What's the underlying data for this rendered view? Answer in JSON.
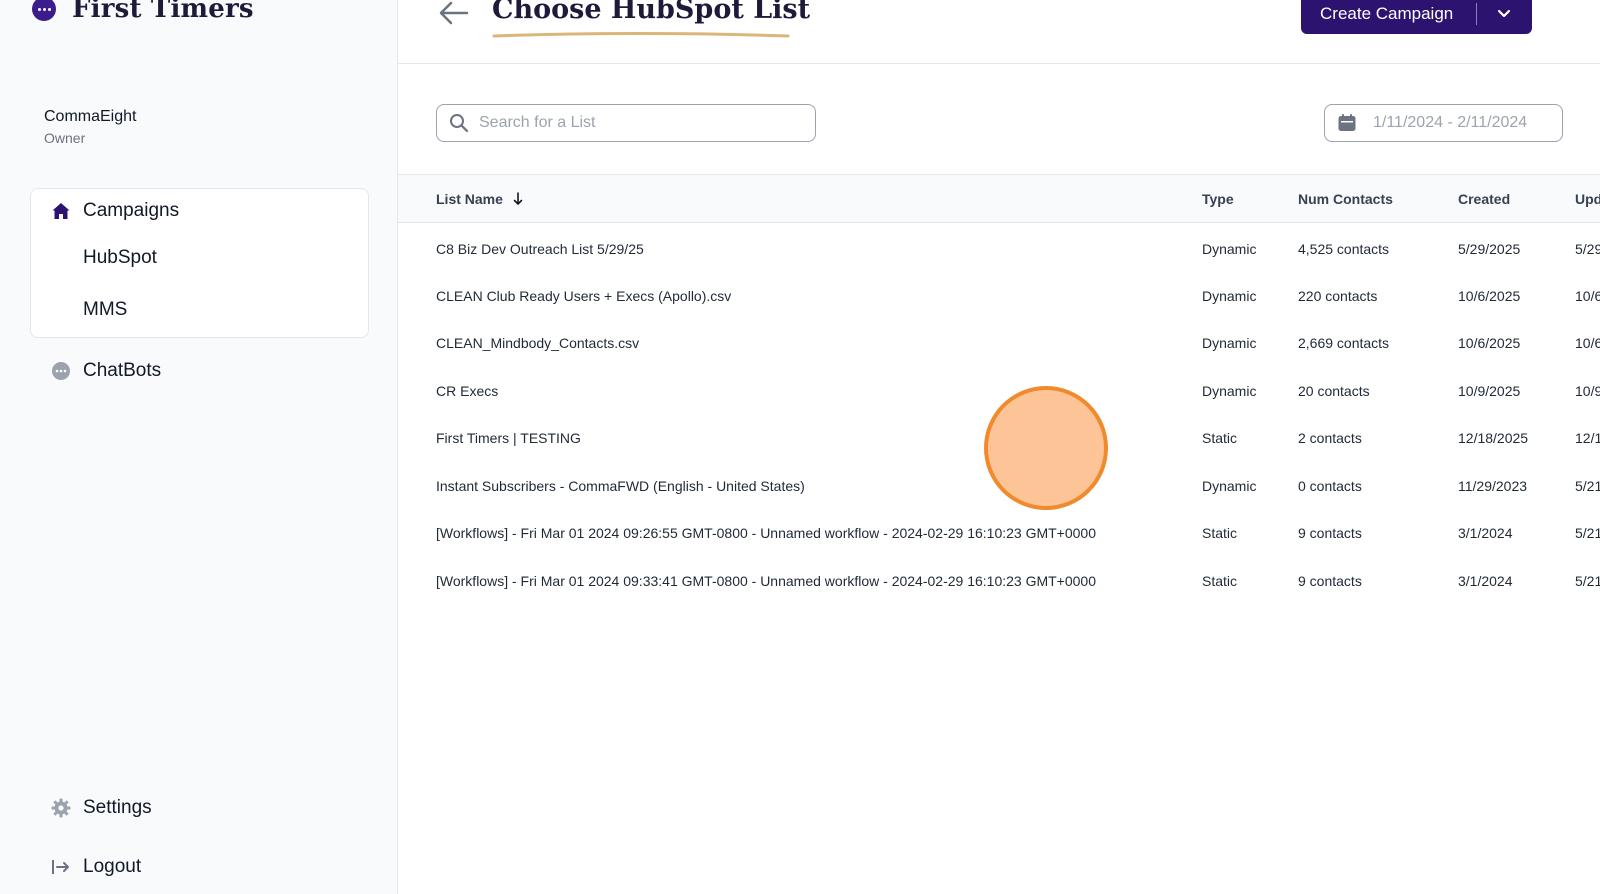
{
  "brand": {
    "name": "First Timers"
  },
  "user": {
    "name": "CommaEight",
    "role": "Owner"
  },
  "nav": {
    "campaigns": "Campaigns",
    "hubspot": "HubSpot",
    "mms": "MMS",
    "chatbots": "ChatBots",
    "settings": "Settings",
    "logout": "Logout"
  },
  "header": {
    "title": "Choose HubSpot List",
    "create_label": "Create Campaign"
  },
  "search": {
    "placeholder": "Search for a List",
    "value": ""
  },
  "date_range": {
    "value": "1/11/2024 - 2/11/2024"
  },
  "table": {
    "headers": {
      "name": "List Name",
      "type": "Type",
      "num": "Num Contacts",
      "created": "Created",
      "updated": "Upd"
    },
    "rows": [
      {
        "name": "C8 Biz Dev Outreach List 5/29/25",
        "type": "Dynamic",
        "num": "4,525 contacts",
        "created": "5/29/2025",
        "updated": "5/29"
      },
      {
        "name": "CLEAN Club Ready Users + Execs (Apollo).csv",
        "type": "Dynamic",
        "num": "220 contacts",
        "created": "10/6/2025",
        "updated": "10/6"
      },
      {
        "name": "CLEAN_Mindbody_Contacts.csv",
        "type": "Dynamic",
        "num": "2,669 contacts",
        "created": "10/6/2025",
        "updated": "10/6"
      },
      {
        "name": "CR Execs",
        "type": "Dynamic",
        "num": "20 contacts",
        "created": "10/9/2025",
        "updated": "10/9"
      },
      {
        "name": "First Timers | TESTING",
        "type": "Static",
        "num": "2 contacts",
        "created": "12/18/2025",
        "updated": "12/1"
      },
      {
        "name": "Instant Subscribers - CommaFWD (English - United States)",
        "type": "Dynamic",
        "num": "0 contacts",
        "created": "11/29/2023",
        "updated": "5/21"
      },
      {
        "name": "[Workflows] - Fri Mar 01 2024 09:26:55 GMT-0800 - Unnamed workflow - 2024-02-29 16:10:23 GMT+0000",
        "type": "Static",
        "num": "9 contacts",
        "created": "3/1/2024",
        "updated": "5/21"
      },
      {
        "name": "[Workflows] - Fri Mar 01 2024 09:33:41 GMT-0800 - Unnamed workflow - 2024-02-29 16:10:23 GMT+0000",
        "type": "Static",
        "num": "9 contacts",
        "created": "3/1/2024",
        "updated": "5/21"
      }
    ]
  },
  "colors": {
    "brand": "#2d1370",
    "accent": "#f08a2c",
    "underline": "#d9b77a"
  },
  "icons": [
    "brand-chat-icon",
    "home-icon",
    "chat-bubble-icon",
    "gear-icon",
    "logout-icon",
    "back-arrow-icon",
    "chevron-down-icon",
    "search-icon",
    "calendar-icon",
    "sort-down-icon"
  ]
}
